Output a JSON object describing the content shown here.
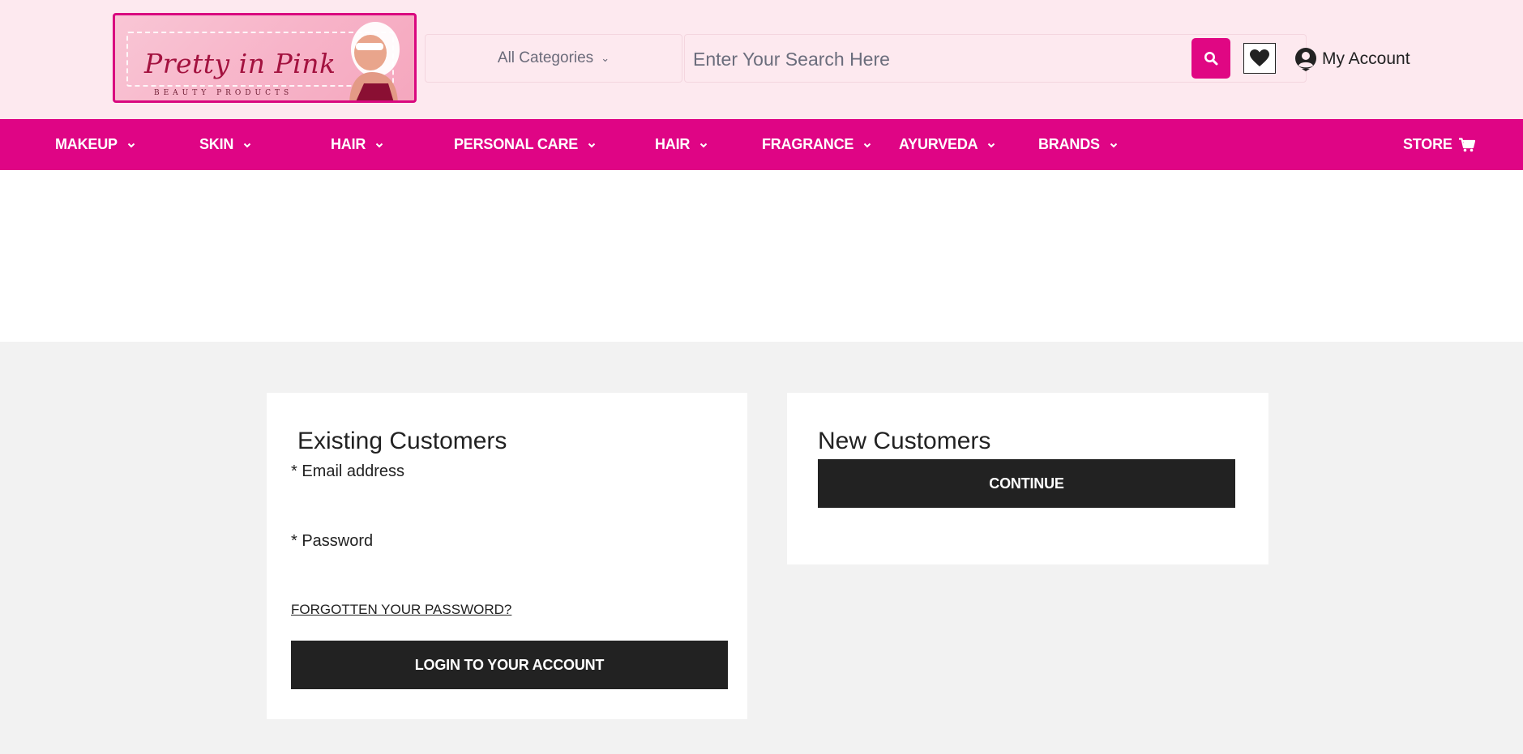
{
  "header": {
    "logo": {
      "name": "Pretty in Pink",
      "tagline": "BEAUTY PRODUCTS"
    },
    "category_select": {
      "value": "All Categories",
      "icon": "chevron-down-icon"
    },
    "search": {
      "placeholder": "Enter Your Search Here",
      "value": "",
      "button_icon": "search-icon"
    },
    "wishlist_icon": "heart-icon",
    "account": {
      "label": "My Account",
      "icon": "user-circle-icon"
    }
  },
  "nav": {
    "items": [
      {
        "label": "MAKEUP"
      },
      {
        "label": "SKIN"
      },
      {
        "label": "HAIR"
      },
      {
        "label": "PERSONAL CARE"
      },
      {
        "label": "HAIR"
      },
      {
        "label": "FRAGRANCE"
      },
      {
        "label": "AYURVEDA"
      },
      {
        "label": "BRANDS"
      }
    ],
    "store": {
      "label": "STORE",
      "icon": "cart-icon"
    }
  },
  "existing": {
    "title": "Existing Customers",
    "email_label": "* Email address",
    "password_label": "* Password",
    "forgot_link": "FORGOTTEN YOUR PASSWORD?",
    "login_button": "LOGIN TO YOUR ACCOUNT"
  },
  "new_customers": {
    "title": "New Customers",
    "continue_button": "CONTINUE"
  },
  "colors": {
    "accent": "#df0585",
    "header_bg": "#fde9ef",
    "button_dark": "#222222",
    "page_gray": "#f2f2f2"
  }
}
